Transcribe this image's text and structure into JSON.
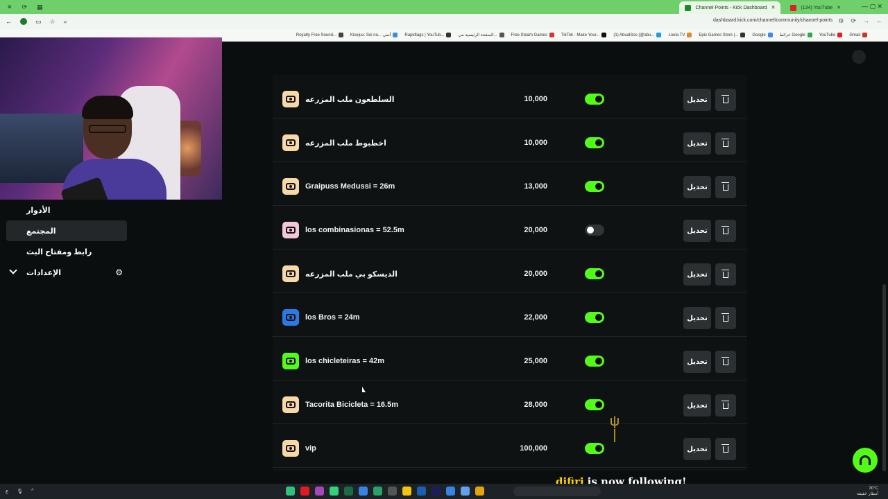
{
  "browser": {
    "tabs": [
      {
        "label": "Channel Points - Kick Dashboard",
        "active": true,
        "favicon_color": "#1b8a2b"
      },
      {
        "label": "(134) YouTube",
        "active": false,
        "favicon_color": "#e02020"
      }
    ],
    "url": "dashboard.kick.com/channel/community/channel-points",
    "bookmarks": [
      {
        "label": "Royalty Free Sound...",
        "color": "#444"
      },
      {
        "label": "Kisejuu: Sei no... أنمي",
        "color": "#3a8ee6"
      },
      {
        "label": "Rapidtags | YouTub...",
        "color": "#333"
      },
      {
        "label": "الصفحة الرئيسية مي...",
        "color": "#555"
      },
      {
        "label": "Free Steam Games",
        "color": "#d33"
      },
      {
        "label": "TikTok - Make Your...",
        "color": "#111"
      },
      {
        "label": "(1) AbualSos (@abu...",
        "color": "#1d9bf0"
      },
      {
        "label": "Loola TV",
        "color": "#e08a2a"
      },
      {
        "label": "Epic Games Store |...",
        "color": "#333"
      },
      {
        "label": "Google",
        "color": "#4285f4"
      },
      {
        "label": "خرائط Google",
        "color": "#34a853"
      },
      {
        "label": "YouTube",
        "color": "#e02020"
      },
      {
        "label": "Gmail",
        "color": "#d93025"
      }
    ]
  },
  "sidebar": {
    "items": [
      {
        "label": "الأدوار",
        "active": false
      },
      {
        "label": "المجتمع",
        "active": true
      },
      {
        "label": "رابط ومفتاح البث",
        "active": false
      },
      {
        "label": "الإعدادات",
        "active": false
      }
    ],
    "settings_icon": "gear-icon",
    "expand_icon": "chevron-down-icon"
  },
  "rewards": [
    {
      "title": "السلطعون ملب المزرعه",
      "cost": "10,000",
      "enabled": true,
      "color": "#f7d9a8"
    },
    {
      "title": "اخطبوط ملب المزرعه",
      "cost": "10,000",
      "enabled": true,
      "color": "#f7d9a8"
    },
    {
      "title": "Graipuss Medussi = 26m",
      "cost": "13,000",
      "enabled": true,
      "color": "#f7d9a8"
    },
    {
      "title": "los combinasionas = 52.5m",
      "cost": "20,000",
      "enabled": false,
      "color": "#f3c6d8"
    },
    {
      "title": "الديسكو بي ملب المزرعه",
      "cost": "20,000",
      "enabled": true,
      "color": "#f7d9a8"
    },
    {
      "title": "los Bros = 24m",
      "cost": "22,000",
      "enabled": true,
      "color": "#2b7ae4"
    },
    {
      "title": "los chicleteiras = 42m",
      "cost": "25,000",
      "enabled": true,
      "color": "#53fc18"
    },
    {
      "title": "Tacorita Bicicleta = 16.5m",
      "cost": "28,000",
      "enabled": true,
      "color": "#f7d9a8"
    },
    {
      "title": "vip",
      "cost": "100,000",
      "enabled": true,
      "color": "#f7d9a8"
    }
  ],
  "row_actions": {
    "edit_label": "تحديل",
    "delete_icon": "trash-icon"
  },
  "colors": {
    "accent": "#53fc18",
    "background": "#0b0e0f",
    "panel": "#0e1213",
    "button": "#2b3033"
  },
  "alert": {
    "username": "difirj",
    "message": "is now following!"
  },
  "taskbar": {
    "tray_temp": "30°C",
    "tray_time": "أمطار خفيفة"
  }
}
